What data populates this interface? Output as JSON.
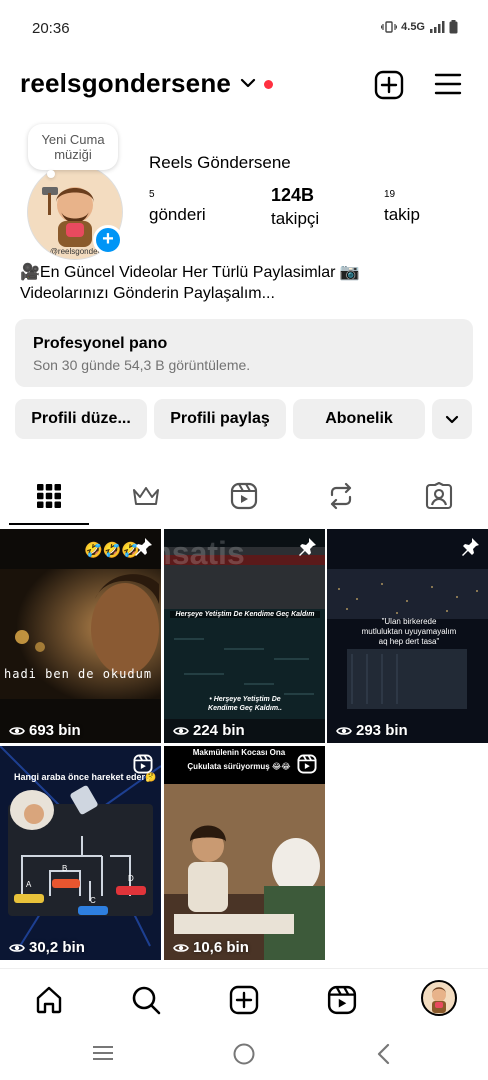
{
  "status": {
    "time": "20:36",
    "network": "4.5G"
  },
  "header": {
    "username": "reelsgondersene"
  },
  "note": {
    "text": "Yeni Cuma müziği"
  },
  "profile": {
    "display_name": "Reels Göndersene",
    "avatar_tag": "@reelsgonder",
    "stats": [
      {
        "value": "5",
        "label": "gönderi"
      },
      {
        "value": "124B",
        "label": "takipçi"
      },
      {
        "value": "19",
        "label": "takip"
      }
    ],
    "bio_line1": "🎥En Güncel Videolar Her Türlü Paylasimlar 📷",
    "bio_line2": "Videolarınızı Gönderin Paylaşalım..."
  },
  "dashboard": {
    "title": "Profesyonel pano",
    "subtitle": "Son 30 günde 54,3 B görüntüleme."
  },
  "buttons": {
    "edit": "Profili düze...",
    "share": "Profili paylaş",
    "subscribe": "Abonelik"
  },
  "tabs": [
    "grid-icon",
    "crown-icon",
    "reels-icon",
    "repost-icon",
    "tagged-icon"
  ],
  "watermark": "itemsatis",
  "posts": [
    {
      "views": "693 bin",
      "overlay": "hadi ben de okudum",
      "emoji": "🤣🤣🤣",
      "pinned": true
    },
    {
      "views": "224 bin",
      "overlay": "Herşeye Yetiştim De Kendime Geç Kaldım",
      "caption": "• Herşeye Yetiştim De Kendime Geç Kaldım..",
      "pinned": true
    },
    {
      "views": "293 bin",
      "overlay": "\"Ulan birkerede mutluluktan uyuyamayalım aq hep dert tasa\"",
      "pinned": true
    },
    {
      "views": "30,2 bin",
      "overlay": "Hangi araba önce hareket eder",
      "emoji": "🤔",
      "labels": [
        "A",
        "B",
        "C",
        "D"
      ],
      "reel": true
    },
    {
      "views": "10,6 bin",
      "overlay": "Makmülenin Kocası Ona Çukulata sürüyormuş 😂😂",
      "reel": true
    }
  ],
  "colors": {
    "accent": "#0095f6",
    "dot": "#ff3040",
    "button_bg": "#efefef",
    "muted": "#737373"
  }
}
